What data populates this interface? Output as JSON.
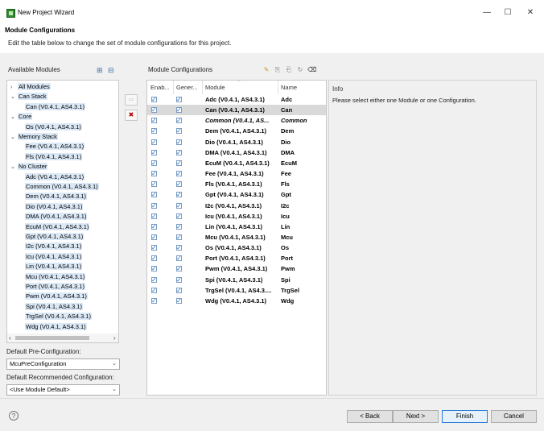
{
  "window": {
    "title": "New Project Wizard",
    "minimize_label": "—",
    "maximize_label": "☐",
    "close_label": "✕"
  },
  "header": {
    "title": "Module Configurations",
    "description": "Edit the table below to change the set of module configurations for this project."
  },
  "available_modules": {
    "label": "Available Modules",
    "expand_label": "⊞",
    "collapse_label": "⊟",
    "tree": [
      {
        "label": "All Modules",
        "chevron": "›"
      },
      {
        "label": "Can Stack",
        "chevron": "⌄"
      },
      {
        "label": "Can (V0.4.1, AS4.3.1)",
        "chevron": ""
      },
      {
        "label": "Core",
        "chevron": "⌄"
      },
      {
        "label": "Os (V0.4.1, AS4.3.1)",
        "chevron": ""
      },
      {
        "label": "Memory Stack",
        "chevron": "⌄"
      },
      {
        "label": "Fee (V0.4.1, AS4.3.1)",
        "chevron": ""
      },
      {
        "label": "Fls (V0.4.1, AS4.3.1)",
        "chevron": ""
      },
      {
        "label": "No Cluster",
        "chevron": "⌄"
      },
      {
        "label": "Adc (V0.4.1, AS4.3.1)",
        "chevron": ""
      },
      {
        "label": "Common (V0.4.1, AS4.3.1)",
        "chevron": ""
      },
      {
        "label": "Dem (V0.4.1, AS4.3.1)",
        "chevron": ""
      },
      {
        "label": "Dio (V0.4.1, AS4.3.1)",
        "chevron": ""
      },
      {
        "label": "DMA (V0.4.1, AS4.3.1)",
        "chevron": ""
      },
      {
        "label": "EcuM (V0.4.1, AS4.3.1)",
        "chevron": ""
      },
      {
        "label": "Gpt (V0.4.1, AS4.3.1)",
        "chevron": ""
      },
      {
        "label": "I2c (V0.4.1, AS4.3.1)",
        "chevron": ""
      },
      {
        "label": "Icu (V0.4.1, AS4.3.1)",
        "chevron": ""
      },
      {
        "label": "Lin (V0.4.1, AS4.3.1)",
        "chevron": ""
      },
      {
        "label": "Mcu (V0.4.1, AS4.3.1)",
        "chevron": ""
      },
      {
        "label": "Port (V0.4.1, AS4.3.1)",
        "chevron": ""
      },
      {
        "label": "Pwm (V0.4.1, AS4.3.1)",
        "chevron": ""
      },
      {
        "label": "Spi (V0.4.1, AS4.3.1)",
        "chevron": ""
      },
      {
        "label": "TrgSel (V0.4.1, AS4.3.1)",
        "chevron": ""
      },
      {
        "label": "Wdg (V0.4.1, AS4.3.1)",
        "chevron": ""
      }
    ],
    "scroll_left": "‹",
    "scroll_right": "›"
  },
  "default_pre_configuration": {
    "label": "Default Pre-Configuration:",
    "value": "McuPreConfiguration"
  },
  "default_recommended_configuration": {
    "label": "Default Recommended Configuration:",
    "value": "<Use Module Default>"
  },
  "module_configurations": {
    "label": "Module Configurations",
    "columns": [
      "Enab...",
      "Gener...",
      "Module",
      "Name"
    ],
    "sort_indicator": "^",
    "rows": [
      {
        "module": "Adc (V0.4.1, AS4.3.1)",
        "name": "Adc"
      },
      {
        "module": "Can (V0.4.1, AS4.3.1)",
        "name": "Can"
      },
      {
        "module": "Common (V0.4.1, AS...",
        "name": "Common"
      },
      {
        "module": "Dem (V0.4.1, AS4.3.1)",
        "name": "Dem"
      },
      {
        "module": "Dio (V0.4.1, AS4.3.1)",
        "name": "Dio"
      },
      {
        "module": "DMA (V0.4.1, AS4.3.1)",
        "name": "DMA"
      },
      {
        "module": "EcuM (V0.4.1, AS4.3.1)",
        "name": "EcuM"
      },
      {
        "module": "Fee (V0.4.1, AS4.3.1)",
        "name": "Fee"
      },
      {
        "module": "Fls (V0.4.1, AS4.3.1)",
        "name": "Fls"
      },
      {
        "module": "Gpt (V0.4.1, AS4.3.1)",
        "name": "Gpt"
      },
      {
        "module": "I2c (V0.4.1, AS4.3.1)",
        "name": "I2c"
      },
      {
        "module": "Icu (V0.4.1, AS4.3.1)",
        "name": "Icu"
      },
      {
        "module": "Lin (V0.4.1, AS4.3.1)",
        "name": "Lin"
      },
      {
        "module": "Mcu (V0.4.1, AS4.3.1)",
        "name": "Mcu"
      },
      {
        "module": "Os (V0.4.1, AS4.3.1)",
        "name": "Os"
      },
      {
        "module": "Port (V0.4.1, AS4.3.1)",
        "name": "Port"
      },
      {
        "module": "Pwm (V0.4.1, AS4.3.1)",
        "name": "Pwm"
      },
      {
        "module": "Spi (V0.4.1, AS4.3.1)",
        "name": "Spi"
      },
      {
        "module": "TrgSel (V0.4.1, AS4.3....",
        "name": "TrgSel"
      },
      {
        "module": "Wdg (V0.4.1, AS4.3.1)",
        "name": "Wdg"
      }
    ],
    "toolbar_icons": [
      "wand-icon",
      "copy-icon",
      "paste-icon",
      "refresh-icon",
      "clear-icon"
    ]
  },
  "info": {
    "title": "Info",
    "message": "Please select either one Module or one Configuration."
  },
  "buttons": {
    "help": "?",
    "back": "< Back",
    "next": "Next >",
    "finish": "Finish",
    "cancel": "Cancel"
  }
}
